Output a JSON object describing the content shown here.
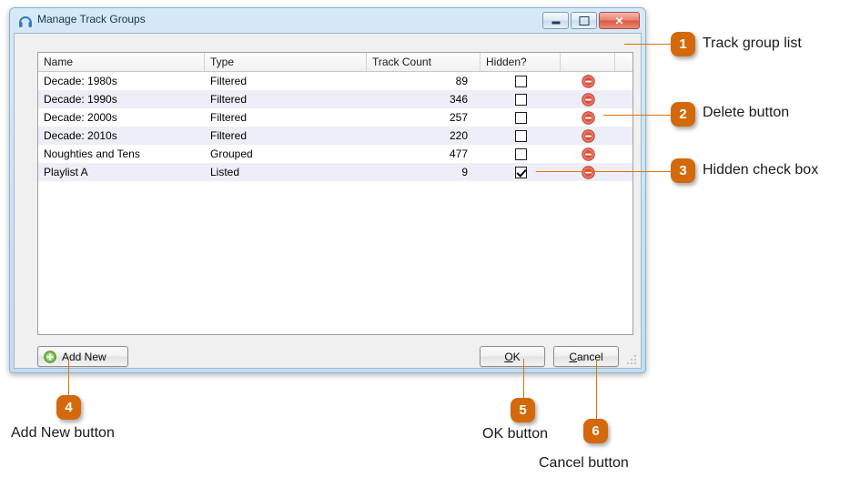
{
  "window": {
    "title": "Manage Track Groups",
    "icon": "headphones-icon",
    "controls": {
      "minimize": "Minimize",
      "maximize": "Maximize",
      "close": "Close"
    }
  },
  "grid": {
    "columns": [
      "Name",
      "Type",
      "Track Count",
      "Hidden?"
    ],
    "rows": [
      {
        "name": "Decade: 1980s",
        "type": "Filtered",
        "count": "89",
        "hidden": false
      },
      {
        "name": "Decade: 1990s",
        "type": "Filtered",
        "count": "346",
        "hidden": false
      },
      {
        "name": "Decade: 2000s",
        "type": "Filtered",
        "count": "257",
        "hidden": false
      },
      {
        "name": "Decade: 2010s",
        "type": "Filtered",
        "count": "220",
        "hidden": false
      },
      {
        "name": "Noughties and Tens",
        "type": "Grouped",
        "count": "477",
        "hidden": false
      },
      {
        "name": "Playlist A",
        "type": "Listed",
        "count": "9",
        "hidden": true
      }
    ]
  },
  "buttons": {
    "add_new": "Add New",
    "ok_mnemonic": "O",
    "ok_rest": "K",
    "cancel_mnemonic": "C",
    "cancel_rest": "ancel"
  },
  "annotations": [
    {
      "number": "1",
      "label": "Track group list"
    },
    {
      "number": "2",
      "label": "Delete button"
    },
    {
      "number": "3",
      "label": "Hidden check box"
    },
    {
      "number": "4",
      "label": "Add New button"
    },
    {
      "number": "5",
      "label": "OK button"
    },
    {
      "number": "6",
      "label": "Cancel button"
    }
  ],
  "colors": {
    "accent": "#d3690b",
    "leader": "#e2700e",
    "delete_icon": "#d94f3d",
    "add_icon": "#5aa832",
    "row_alt": "#edeef7"
  }
}
